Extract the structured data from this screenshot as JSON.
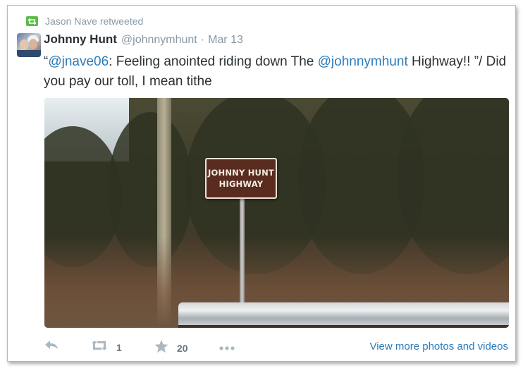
{
  "retweet_context": {
    "text": "Jason Nave retweeted",
    "icon": "retweet-icon"
  },
  "author": {
    "name": "Johnny Hunt",
    "handle": "@johnnymhunt",
    "separator": "·",
    "date": "Mar 13"
  },
  "tweet": {
    "open_quote": "“",
    "mention1": "@jnave06",
    "text1": ": Feeling anointed riding down The ",
    "mention2": "@johnnymhunt",
    "text2": " Highway!! ”/ Did you pay our toll, I mean tithe"
  },
  "photo": {
    "sign_line1": "JOHNNY HUNT",
    "sign_line2": "HIGHWAY"
  },
  "actions": {
    "reply_icon": "reply-icon",
    "retweet_icon": "retweet-icon",
    "retweet_count": "1",
    "favorite_icon": "star-icon",
    "favorite_count": "20",
    "more_icon": "more-icon",
    "view_more_label": "View more photos and videos"
  },
  "colors": {
    "link": "#2b7bb9",
    "muted": "#8899a6",
    "retweet_green": "#5bbd49"
  }
}
